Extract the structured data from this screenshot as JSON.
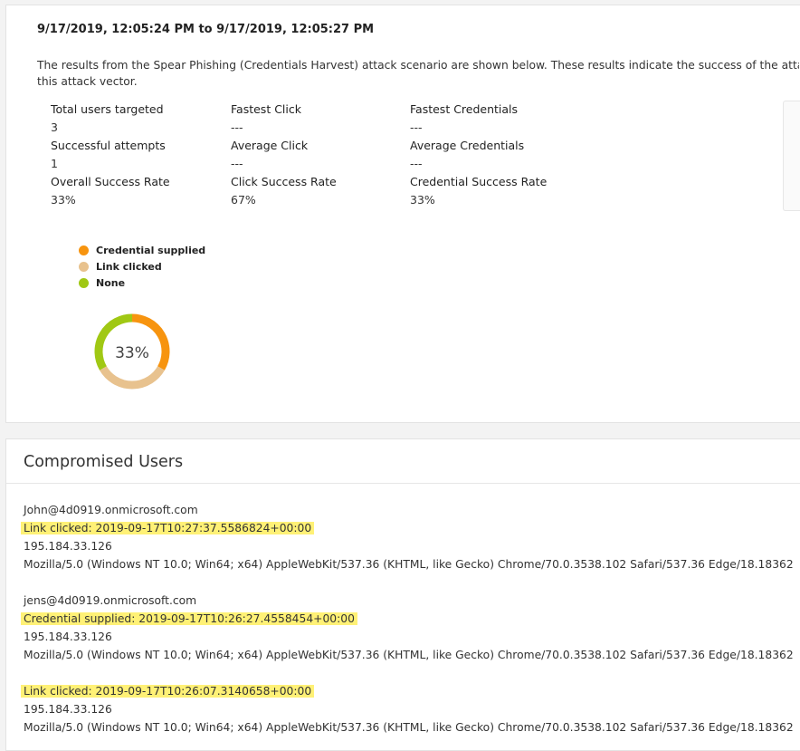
{
  "summary": {
    "date_range": "9/17/2019, 12:05:24 PM to 9/17/2019, 12:05:27 PM",
    "description_line1": "The results from the Spear Phishing (Credentials Harvest) attack scenario are shown below. These results indicate the success of the attack",
    "description_line2": "this attack vector.",
    "stats": [
      {
        "label": "Total users targeted",
        "value": "3"
      },
      {
        "label": "Fastest Click",
        "value": "---"
      },
      {
        "label": "Fastest Credentials",
        "value": "---"
      },
      {
        "label": "Successful attempts",
        "value": "1"
      },
      {
        "label": "Average Click",
        "value": "---"
      },
      {
        "label": "Average Credentials",
        "value": "---"
      },
      {
        "label": "Overall Success Rate",
        "value": "33%"
      },
      {
        "label": "Click Success Rate",
        "value": "67%"
      },
      {
        "label": "Credential Success Rate",
        "value": "33%"
      }
    ]
  },
  "chart_data": {
    "type": "pie",
    "title": "",
    "categories": [
      "Credential supplied",
      "Link clicked",
      "None"
    ],
    "values": [
      1,
      1,
      1
    ],
    "colors": [
      "#f7940f",
      "#e8c28e",
      "#a0c814"
    ],
    "center_label": "33%",
    "legend_placement": "top-left"
  },
  "compromised": {
    "title": "Compromised Users",
    "entries": [
      {
        "email": "John@4d0919.onmicrosoft.com",
        "event": "Link clicked: 2019-09-17T10:27:37.5586824+00:00",
        "ip": "195.184.33.126",
        "agent": "Mozilla/5.0 (Windows NT 10.0; Win64; x64) AppleWebKit/537.36 (KHTML, like Gecko) Chrome/70.0.3538.102 Safari/537.36 Edge/18.18362"
      },
      {
        "email": "jens@4d0919.onmicrosoft.com",
        "event": "Credential supplied: 2019-09-17T10:26:27.4558454+00:00",
        "ip": "195.184.33.126",
        "agent": "Mozilla/5.0 (Windows NT 10.0; Win64; x64) AppleWebKit/537.36 (KHTML, like Gecko) Chrome/70.0.3538.102 Safari/537.36 Edge/18.18362"
      },
      {
        "email": "",
        "event": "Link clicked: 2019-09-17T10:26:07.3140658+00:00",
        "ip": "195.184.33.126",
        "agent": "Mozilla/5.0 (Windows NT 10.0; Win64; x64) AppleWebKit/537.36 (KHTML, like Gecko) Chrome/70.0.3538.102 Safari/537.36 Edge/18.18362"
      }
    ]
  }
}
